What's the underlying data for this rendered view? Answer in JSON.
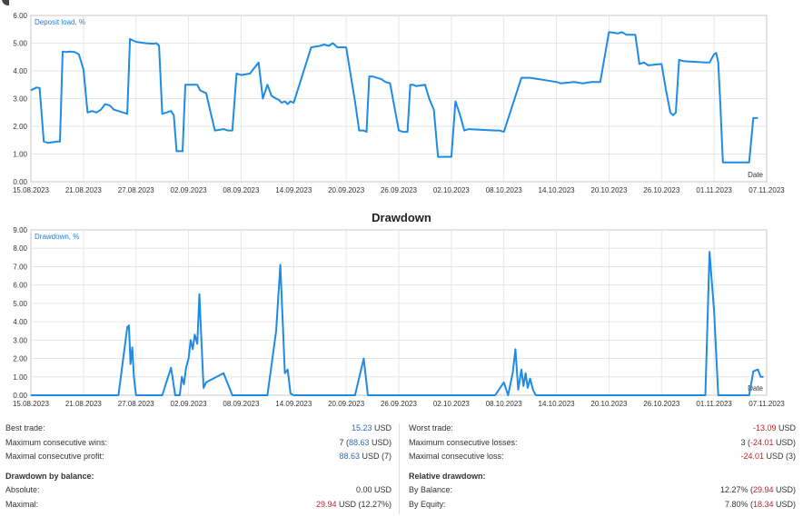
{
  "colors": {
    "line": "#1e8be6",
    "grid": "#e6e6e6",
    "frame": "#c8c8c8",
    "blue_val": "#2f6db7",
    "red_val": "#c0232c"
  },
  "charts": [
    {
      "id": "deposit",
      "inner_label": "Deposit load, %",
      "corner_label": "Date",
      "title": ""
    },
    {
      "id": "drawdown",
      "inner_label": "Drawdown, %",
      "corner_label": "Date",
      "title": "Drawdown"
    }
  ],
  "chart_data": [
    {
      "type": "line",
      "title": "",
      "ylabel": "Deposit load, %",
      "xlabel": "Date",
      "ylim": [
        0.0,
        6.0
      ],
      "yticks": [
        "0.00",
        "1.00",
        "2.00",
        "3.00",
        "4.00",
        "5.00",
        "6.00"
      ],
      "xlim": [
        "2023-08-15",
        "2023-11-07"
      ],
      "xticks": [
        "15.08.2023",
        "21.08.2023",
        "27.08.2023",
        "02.09.2023",
        "08.09.2023",
        "14.09.2023",
        "20.09.2023",
        "26.09.2023",
        "02.10.2023",
        "08.10.2023",
        "14.10.2023",
        "20.10.2023",
        "26.10.2023",
        "01.11.2023",
        "07.11.2023"
      ],
      "grid": true,
      "series": [
        {
          "x": [
            "2023-08-15",
            "2023-08-15",
            "2023-08-15",
            "2023-08-16",
            "2023-08-16",
            "2023-08-17",
            "2023-08-18",
            "2023-08-18",
            "2023-08-18",
            "2023-08-19",
            "2023-08-19",
            "2023-08-20",
            "2023-08-20",
            "2023-08-21",
            "2023-08-21",
            "2023-08-22",
            "2023-08-22",
            "2023-08-23",
            "2023-08-23",
            "2023-08-24",
            "2023-08-24",
            "2023-08-25",
            "2023-08-26",
            "2023-08-26",
            "2023-08-26",
            "2023-08-27",
            "2023-08-28",
            "2023-08-29",
            "2023-08-29",
            "2023-08-29",
            "2023-08-30",
            "2023-08-31",
            "2023-08-31",
            "2023-08-31",
            "2023-09-01",
            "2023-09-01",
            "2023-09-01",
            "2023-09-02",
            "2023-09-03",
            "2023-09-03",
            "2023-09-03",
            "2023-09-04",
            "2023-09-05",
            "2023-09-06",
            "2023-09-06",
            "2023-09-07",
            "2023-09-07",
            "2023-09-08",
            "2023-09-09",
            "2023-09-10",
            "2023-09-10",
            "2023-09-11",
            "2023-09-11",
            "2023-09-12",
            "2023-09-12",
            "2023-09-12",
            "2023-09-13",
            "2023-09-13",
            "2023-09-13",
            "2023-09-14",
            "2023-09-16",
            "2023-09-17",
            "2023-09-17",
            "2023-09-18",
            "2023-09-18",
            "2023-09-19",
            "2023-09-20",
            "2023-09-21",
            "2023-09-21",
            "2023-09-22",
            "2023-09-22",
            "2023-09-22",
            "2023-09-23",
            "2023-09-23",
            "2023-09-24",
            "2023-09-24",
            "2023-09-25",
            "2023-09-26",
            "2023-09-26",
            "2023-09-27",
            "2023-09-27",
            "2023-09-27",
            "2023-09-28",
            "2023-09-29",
            "2023-09-29",
            "2023-09-30",
            "2023-09-30",
            "2023-10-01",
            "2023-10-02",
            "2023-10-02",
            "2023-10-03",
            "2023-10-03",
            "2023-10-04",
            "2023-10-07",
            "2023-10-07",
            "2023-10-08",
            "2023-10-10",
            "2023-10-11",
            "2023-10-12",
            "2023-10-13",
            "2023-10-14",
            "2023-10-14",
            "2023-10-16",
            "2023-10-17",
            "2023-10-18",
            "2023-10-19",
            "2023-10-20",
            "2023-10-21",
            "2023-10-21",
            "2023-10-22",
            "2023-10-23",
            "2023-10-23",
            "2023-10-24",
            "2023-10-24",
            "2023-10-26",
            "2023-10-26",
            "2023-10-27",
            "2023-10-27",
            "2023-10-27",
            "2023-10-28",
            "2023-10-28",
            "2023-10-31",
            "2023-10-31",
            "2023-11-01",
            "2023-11-01",
            "2023-11-01",
            "2023-11-01",
            "2023-11-02",
            "2023-11-04",
            "2023-11-05",
            "2023-11-05",
            "2023-11-06"
          ],
          "y": [
            3.3,
            3.35,
            3.4,
            3.38,
            1.45,
            1.4,
            1.45,
            1.45,
            4.7,
            4.68,
            4.7,
            4.68,
            4.6,
            4.05,
            2.5,
            2.55,
            2.5,
            2.6,
            2.8,
            2.75,
            2.6,
            2.55,
            2.45,
            5.15,
            5.1,
            5.05,
            5.0,
            4.98,
            5.0,
            4.9,
            2.45,
            2.55,
            2.4,
            1.1,
            1.1,
            1.1,
            3.5,
            3.5,
            3.5,
            3.3,
            3.25,
            3.2,
            1.85,
            1.9,
            1.85,
            1.85,
            3.9,
            3.85,
            3.9,
            4.3,
            3.0,
            3.5,
            3.1,
            3.0,
            2.95,
            2.85,
            2.9,
            2.8,
            2.9,
            2.85,
            4.85,
            4.9,
            4.95,
            4.9,
            5.0,
            4.85,
            4.85,
            2.9,
            1.85,
            1.85,
            1.8,
            3.8,
            3.8,
            3.75,
            3.7,
            3.6,
            3.55,
            1.85,
            1.8,
            1.8,
            3.5,
            3.5,
            3.45,
            3.5,
            3.0,
            2.6,
            0.9,
            0.9,
            0.9,
            2.9,
            2.4,
            1.85,
            1.9,
            1.85,
            1.85,
            1.8,
            3.75,
            3.75,
            3.7,
            3.65,
            3.6,
            3.55,
            3.6,
            3.55,
            3.6,
            3.6,
            5.4,
            5.35,
            5.4,
            5.3,
            5.3,
            4.25,
            4.3,
            4.2,
            4.25,
            3.35,
            2.5,
            2.4,
            2.5,
            4.4,
            4.35,
            4.3,
            4.3,
            4.6,
            4.65,
            4.3,
            2.8,
            0.7,
            0.7,
            0.7,
            2.3,
            2.3
          ]
        }
      ]
    },
    {
      "type": "line",
      "title": "Drawdown",
      "ylabel": "Drawdown, %",
      "xlabel": "Date",
      "ylim": [
        0.0,
        9.0
      ],
      "yticks": [
        "0.00",
        "1.00",
        "2.00",
        "3.00",
        "4.00",
        "5.00",
        "6.00",
        "7.00",
        "8.00",
        "9.00"
      ],
      "xlim": [
        "2023-08-15",
        "2023-11-07"
      ],
      "xticks": [
        "15.08.2023",
        "21.08.2023",
        "27.08.2023",
        "02.09.2023",
        "08.09.2023",
        "14.09.2023",
        "20.09.2023",
        "26.09.2023",
        "02.10.2023",
        "08.10.2023",
        "14.10.2023",
        "20.10.2023",
        "26.10.2023",
        "01.11.2023",
        "07.11.2023"
      ],
      "grid": true,
      "series": [
        {
          "x": [
            "2023-08-15",
            "2023-08-25",
            "2023-08-26",
            "2023-08-26",
            "2023-08-26",
            "2023-08-26",
            "2023-08-26",
            "2023-08-27",
            "2023-08-30",
            "2023-08-31",
            "2023-08-31",
            "2023-09-01",
            "2023-09-01",
            "2023-09-01",
            "2023-09-01",
            "2023-09-02",
            "2023-09-02",
            "2023-09-02",
            "2023-09-02",
            "2023-09-03",
            "2023-09-03",
            "2023-09-03",
            "2023-09-03",
            "2023-09-04",
            "2023-09-06",
            "2023-09-07",
            "2023-09-11",
            "2023-09-12",
            "2023-09-12",
            "2023-09-13",
            "2023-09-13",
            "2023-09-13",
            "2023-09-14",
            "2023-09-21",
            "2023-09-22",
            "2023-09-22",
            "2023-10-07",
            "2023-10-08",
            "2023-10-08",
            "2023-10-09",
            "2023-10-09",
            "2023-10-09",
            "2023-10-10",
            "2023-10-10",
            "2023-10-10",
            "2023-10-10",
            "2023-10-11",
            "2023-10-11",
            "2023-10-11",
            "2023-10-31",
            "2023-10-31",
            "2023-11-01",
            "2023-11-01",
            "2023-11-05",
            "2023-11-05",
            "2023-11-06",
            "2023-11-06",
            "2023-11-06"
          ],
          "y": [
            0.0,
            0.0,
            3.7,
            3.8,
            1.7,
            2.6,
            1.0,
            0.0,
            0.0,
            1.5,
            0.0,
            0.0,
            1.0,
            0.6,
            1.5,
            2.0,
            3.0,
            2.5,
            3.3,
            2.8,
            5.5,
            2.9,
            0.4,
            0.7,
            1.2,
            0.0,
            0.0,
            3.5,
            7.1,
            1.2,
            1.4,
            0.1,
            0.0,
            0.0,
            2.0,
            0.0,
            0.0,
            0.7,
            0.0,
            1.2,
            2.5,
            0.3,
            1.4,
            0.5,
            1.2,
            0.4,
            0.9,
            0.3,
            0.0,
            0.0,
            7.8,
            4.6,
            0.0,
            0.0,
            1.3,
            1.4,
            1.0,
            1.0
          ]
        }
      ]
    }
  ],
  "stats": {
    "left": [
      {
        "label": "Best trade:",
        "val1": "15.23",
        "val1_color": "blue",
        "val2": "",
        "suffix": " USD"
      },
      {
        "label": "Maximum consecutive wins:",
        "val1": "7",
        "val1_color": "",
        "val2": "88.63",
        "val2_color": "blue",
        "suffix": " USD)"
      },
      {
        "label": "Maximal consecutive profit:",
        "val1": "88.63",
        "val1_color": "blue",
        "val2": "",
        "suffix": " USD (7)"
      }
    ],
    "left_section": "Drawdown by balance:",
    "left2": [
      {
        "label": "Absolute:",
        "val1": "0.00",
        "val1_color": "",
        "val2": "",
        "suffix": " USD"
      },
      {
        "label": "Maximal:",
        "val1": "29.94",
        "val1_color": "red",
        "val2": "",
        "suffix": " USD (12.27%)"
      }
    ],
    "right": [
      {
        "label": "Worst trade:",
        "val1": "-13.09",
        "val1_color": "red",
        "val2": "",
        "suffix": " USD"
      },
      {
        "label": "Maximum consecutive losses:",
        "val1": "3",
        "val1_color": "",
        "val2": "-24.01",
        "val2_color": "red",
        "suffix": " USD)"
      },
      {
        "label": "Maximal consecutive loss:",
        "val1": "-24.01",
        "val1_color": "red",
        "val2": "",
        "suffix": " USD (3)"
      }
    ],
    "right_section": "Relative drawdown:",
    "right2": [
      {
        "label": "By Balance:",
        "val1": "12.27%",
        "val1_color": "",
        "val2": "29.94",
        "val2_color": "red",
        "suffix": " USD)"
      },
      {
        "label": "By Equity:",
        "val1": "7.80%",
        "val1_color": "",
        "val2": "18.34",
        "val2_color": "red",
        "suffix": " USD)"
      }
    ]
  }
}
